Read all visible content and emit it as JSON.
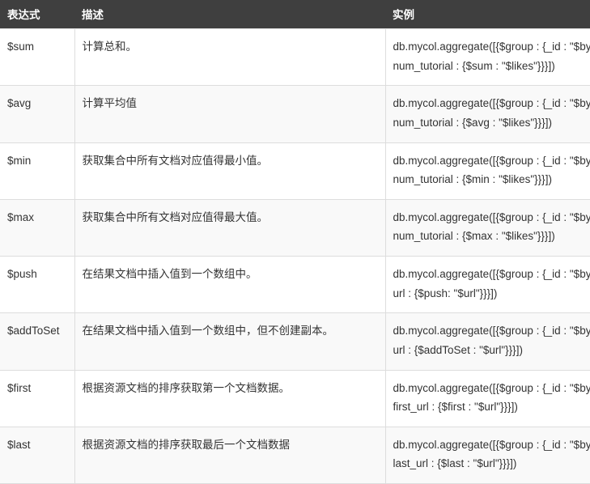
{
  "table": {
    "headers": {
      "expression": "表达式",
      "description": "描述",
      "example": "实例"
    },
    "rows": [
      {
        "expression": "$sum",
        "description": "计算总和。",
        "example": "db.mycol.aggregate([{$group : {_id : \"$by_user\", num_tutorial : {$sum : \"$likes\"}}}])"
      },
      {
        "expression": "$avg",
        "description": "计算平均值",
        "example": "db.mycol.aggregate([{$group : {_id : \"$by_user\", num_tutorial : {$avg : \"$likes\"}}}])"
      },
      {
        "expression": "$min",
        "description": "获取集合中所有文档对应值得最小值。",
        "example": "db.mycol.aggregate([{$group : {_id : \"$by_user\", num_tutorial : {$min : \"$likes\"}}}])"
      },
      {
        "expression": "$max",
        "description": "获取集合中所有文档对应值得最大值。",
        "example": "db.mycol.aggregate([{$group : {_id : \"$by_user\", num_tutorial : {$max : \"$likes\"}}}])"
      },
      {
        "expression": "$push",
        "description": "在结果文档中插入值到一个数组中。",
        "example": "db.mycol.aggregate([{$group : {_id : \"$by_user\", url : {$push: \"$url\"}}}])"
      },
      {
        "expression": "$addToSet",
        "description": "在结果文档中插入值到一个数组中，但不创建副本。",
        "example": "db.mycol.aggregate([{$group : {_id : \"$by_user\", url : {$addToSet : \"$url\"}}}])"
      },
      {
        "expression": "$first",
        "description": "根据资源文档的排序获取第一个文档数据。",
        "example": "db.mycol.aggregate([{$group : {_id : \"$by_user\", first_url : {$first : \"$url\"}}}])"
      },
      {
        "expression": "$last",
        "description": "根据资源文档的排序获取最后一个文档数据",
        "example": "db.mycol.aggregate([{$group : {_id : \"$by_user\", last_url : {$last : \"$url\"}}}])"
      }
    ]
  }
}
